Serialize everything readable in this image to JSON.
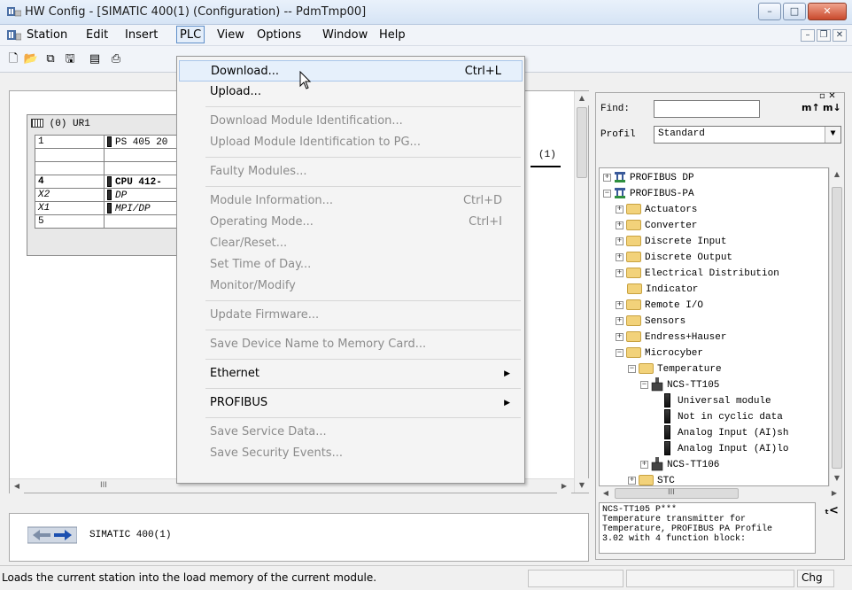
{
  "window": {
    "title": "HW Config - [SIMATIC 400(1) (Configuration) -- PdmTmp00]",
    "controls": {
      "minimize": "–",
      "maximize": "□",
      "close": "✕"
    }
  },
  "menubar": {
    "items": [
      "Station",
      "Edit",
      "Insert",
      "PLC",
      "View",
      "Options",
      "Window",
      "Help"
    ],
    "active": "PLC",
    "mdi": {
      "minimize": "–",
      "restore": "❐",
      "close": "✕"
    }
  },
  "station": {
    "rack_title": "(0) UR1",
    "rows": [
      {
        "slot": "1",
        "module": "PS 405 20"
      },
      {
        "slot": "",
        "module": ""
      },
      {
        "slot": "",
        "module": ""
      },
      {
        "slot": "4",
        "module": "CPU 412-"
      },
      {
        "slot": "X2",
        "module": "DP"
      },
      {
        "slot": "X1",
        "module": "MPI/DP"
      },
      {
        "slot": "5",
        "module": ""
      }
    ],
    "connector_label": "(1)",
    "scroll_marker": "III"
  },
  "detail": {
    "station_name": "SIMATIC 400(1)"
  },
  "dropdown": {
    "items": [
      {
        "label": "Download...",
        "shortcut": "Ctrl+L",
        "enabled": true,
        "highlight": true
      },
      {
        "label": "Upload...",
        "enabled": true
      },
      {
        "sep": true
      },
      {
        "label": "Download Module Identification...",
        "enabled": false
      },
      {
        "label": "Upload Module Identification to PG...",
        "enabled": false
      },
      {
        "sep": true
      },
      {
        "label": "Faulty Modules...",
        "enabled": false
      },
      {
        "sep": true
      },
      {
        "label": "Module Information...",
        "shortcut": "Ctrl+D",
        "enabled": false
      },
      {
        "label": "Operating Mode...",
        "shortcut": "Ctrl+I",
        "enabled": false
      },
      {
        "label": "Clear/Reset...",
        "enabled": false
      },
      {
        "label": "Set Time of Day...",
        "enabled": false
      },
      {
        "label": "Monitor/Modify",
        "enabled": false
      },
      {
        "sep": true
      },
      {
        "label": "Update Firmware...",
        "enabled": false
      },
      {
        "sep": true
      },
      {
        "label": "Save Device Name to Memory Card...",
        "enabled": false
      },
      {
        "sep": true
      },
      {
        "label": "Ethernet",
        "enabled": true,
        "submenu": true
      },
      {
        "sep": true
      },
      {
        "label": "PROFIBUS",
        "enabled": true,
        "submenu": true
      },
      {
        "sep": true
      },
      {
        "label": "Save Service Data...",
        "enabled": false
      },
      {
        "label": "Save Security Events...",
        "enabled": false
      }
    ]
  },
  "catalog": {
    "find_label": "Find:",
    "find_value": "",
    "profil_label": "Profil",
    "profil_value": "Standard",
    "scroll_marker": "III",
    "tree": [
      {
        "label": "PROFIBUS DP",
        "level": 0,
        "icon": "bus",
        "expander": "+"
      },
      {
        "label": "PROFIBUS-PA",
        "level": 0,
        "icon": "bus",
        "expander": "-"
      },
      {
        "label": "Actuators",
        "level": 1,
        "icon": "folder",
        "expander": "+"
      },
      {
        "label": "Converter",
        "level": 1,
        "icon": "folder",
        "expander": "+"
      },
      {
        "label": "Discrete Input",
        "level": 1,
        "icon": "folder",
        "expander": "+"
      },
      {
        "label": "Discrete Output",
        "level": 1,
        "icon": "folder",
        "expander": "+"
      },
      {
        "label": "Electrical Distribution",
        "level": 1,
        "icon": "folder",
        "expander": "+"
      },
      {
        "label": "Indicator",
        "level": 1,
        "icon": "folder",
        "expander": ""
      },
      {
        "label": "Remote I/O",
        "level": 1,
        "icon": "folder",
        "expander": "+"
      },
      {
        "label": "Sensors",
        "level": 1,
        "icon": "folder",
        "expander": "+"
      },
      {
        "label": "Endress+Hauser",
        "level": 1,
        "icon": "folder",
        "expander": "+"
      },
      {
        "label": "Microcyber",
        "level": 1,
        "icon": "folder",
        "expander": "-"
      },
      {
        "label": "Temperature",
        "level": 2,
        "icon": "folder",
        "expander": "-"
      },
      {
        "label": "NCS-TT105",
        "level": 3,
        "icon": "device",
        "expander": "-"
      },
      {
        "label": "Universal module",
        "level": 4,
        "icon": "module",
        "expander": ""
      },
      {
        "label": "Not in cyclic data",
        "level": 4,
        "icon": "module",
        "expander": ""
      },
      {
        "label": "Analog Input (AI)sh",
        "level": 4,
        "icon": "module",
        "expander": ""
      },
      {
        "label": "Analog Input (AI)lo",
        "level": 4,
        "icon": "module",
        "expander": ""
      },
      {
        "label": "NCS-TT106",
        "level": 3,
        "icon": "device",
        "expander": "+"
      },
      {
        "label": "STC",
        "level": 2,
        "icon": "folder",
        "expander": "+"
      }
    ],
    "info_text": "NCS-TT105 P***\nTemperature transmitter for\nTemperature, PROFIBUS PA Profile\n3.02 with 4 function block:"
  },
  "statusbar": {
    "message": "Loads the current station into the load memory of the current module.",
    "mode": "Chg"
  }
}
